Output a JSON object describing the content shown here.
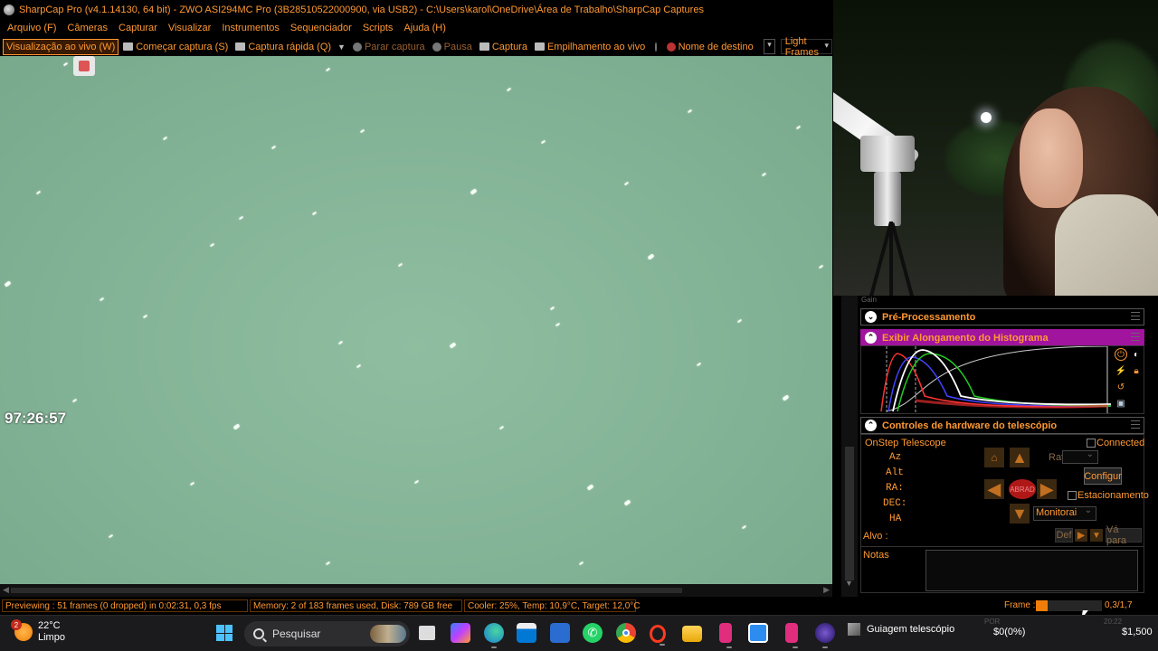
{
  "window": {
    "title": "SharpCap Pro (v4.1.14130, 64 bit) - ZWO ASI294MC Pro (3B28510522000900, via USB2) - C:\\Users\\karol\\OneDrive\\Área de Trabalho\\SharpCap Captures"
  },
  "menu": [
    "Arquivo (F)",
    "Câmeras",
    "Capturar",
    "Visualizar",
    "Instrumentos",
    "Sequenciador",
    "Scripts",
    "Ajuda (H)"
  ],
  "toolbar": {
    "live_view": "Visualização ao vivo (W)",
    "start_capture": "Começar captura (S)",
    "quick_capture": "Captura rápida (Q)",
    "stop_capture": "Parar captura",
    "pause": "Pausa",
    "capture": "Captura",
    "live_stack": "Empilhamento ao vivo",
    "target_name": "Nome de destino",
    "target_name_value": "",
    "frame_type": "Light Frames"
  },
  "image": {
    "timer": "97:26:57"
  },
  "panel": {
    "gain_label": "Gain",
    "preprocessing": "Pré-Processamento",
    "histogram": "Exibir Alongamento do Histograma",
    "hardware": "Controles de hardware do telescópio",
    "telescope_name": "OnStep Telescope",
    "connected": "Connected",
    "connected_checked": false,
    "az": "Az",
    "alt": "Alt",
    "ra": "RA:",
    "dec": "DEC:",
    "ha": "HA",
    "rate_label": "Rate",
    "rate_value": "",
    "configure": "Configur",
    "parking": "Estacionamento",
    "parking_checked": false,
    "tracking_value": "Monitorai",
    "abort": "ABRAD",
    "target_label": "Alvo :",
    "def_button": "Def",
    "goto_button": "Vá para",
    "notes_label": "Notas",
    "notes_value": ""
  },
  "status": {
    "previewing": "Previewing : 51 frames (0 dropped) in 0:02:31, 0,3 fps",
    "memory": "Memory: 2 of 183 frames used, Disk: 789 GB free",
    "cooler": "Cooler: 25%, Temp: 10,9°C, Target: 12,0°C",
    "frame_label": "Frame :",
    "frame_value": "0,3/1,7",
    "frame_progress": 0.18
  },
  "taskbar": {
    "weather_temp": "22°C",
    "weather_desc": "Limpo",
    "weather_badge": "2",
    "search_placeholder": "Pesquisar",
    "active_task": "Guiagem telescópio",
    "tray_money": "$0(0%)",
    "tray_price": "$1,500",
    "tray_dim1": "POR",
    "tray_dim2": "20:22"
  },
  "colors": {
    "accent": "#ff9933",
    "histogram_header": "#a0149e",
    "sky": "#83b396"
  }
}
